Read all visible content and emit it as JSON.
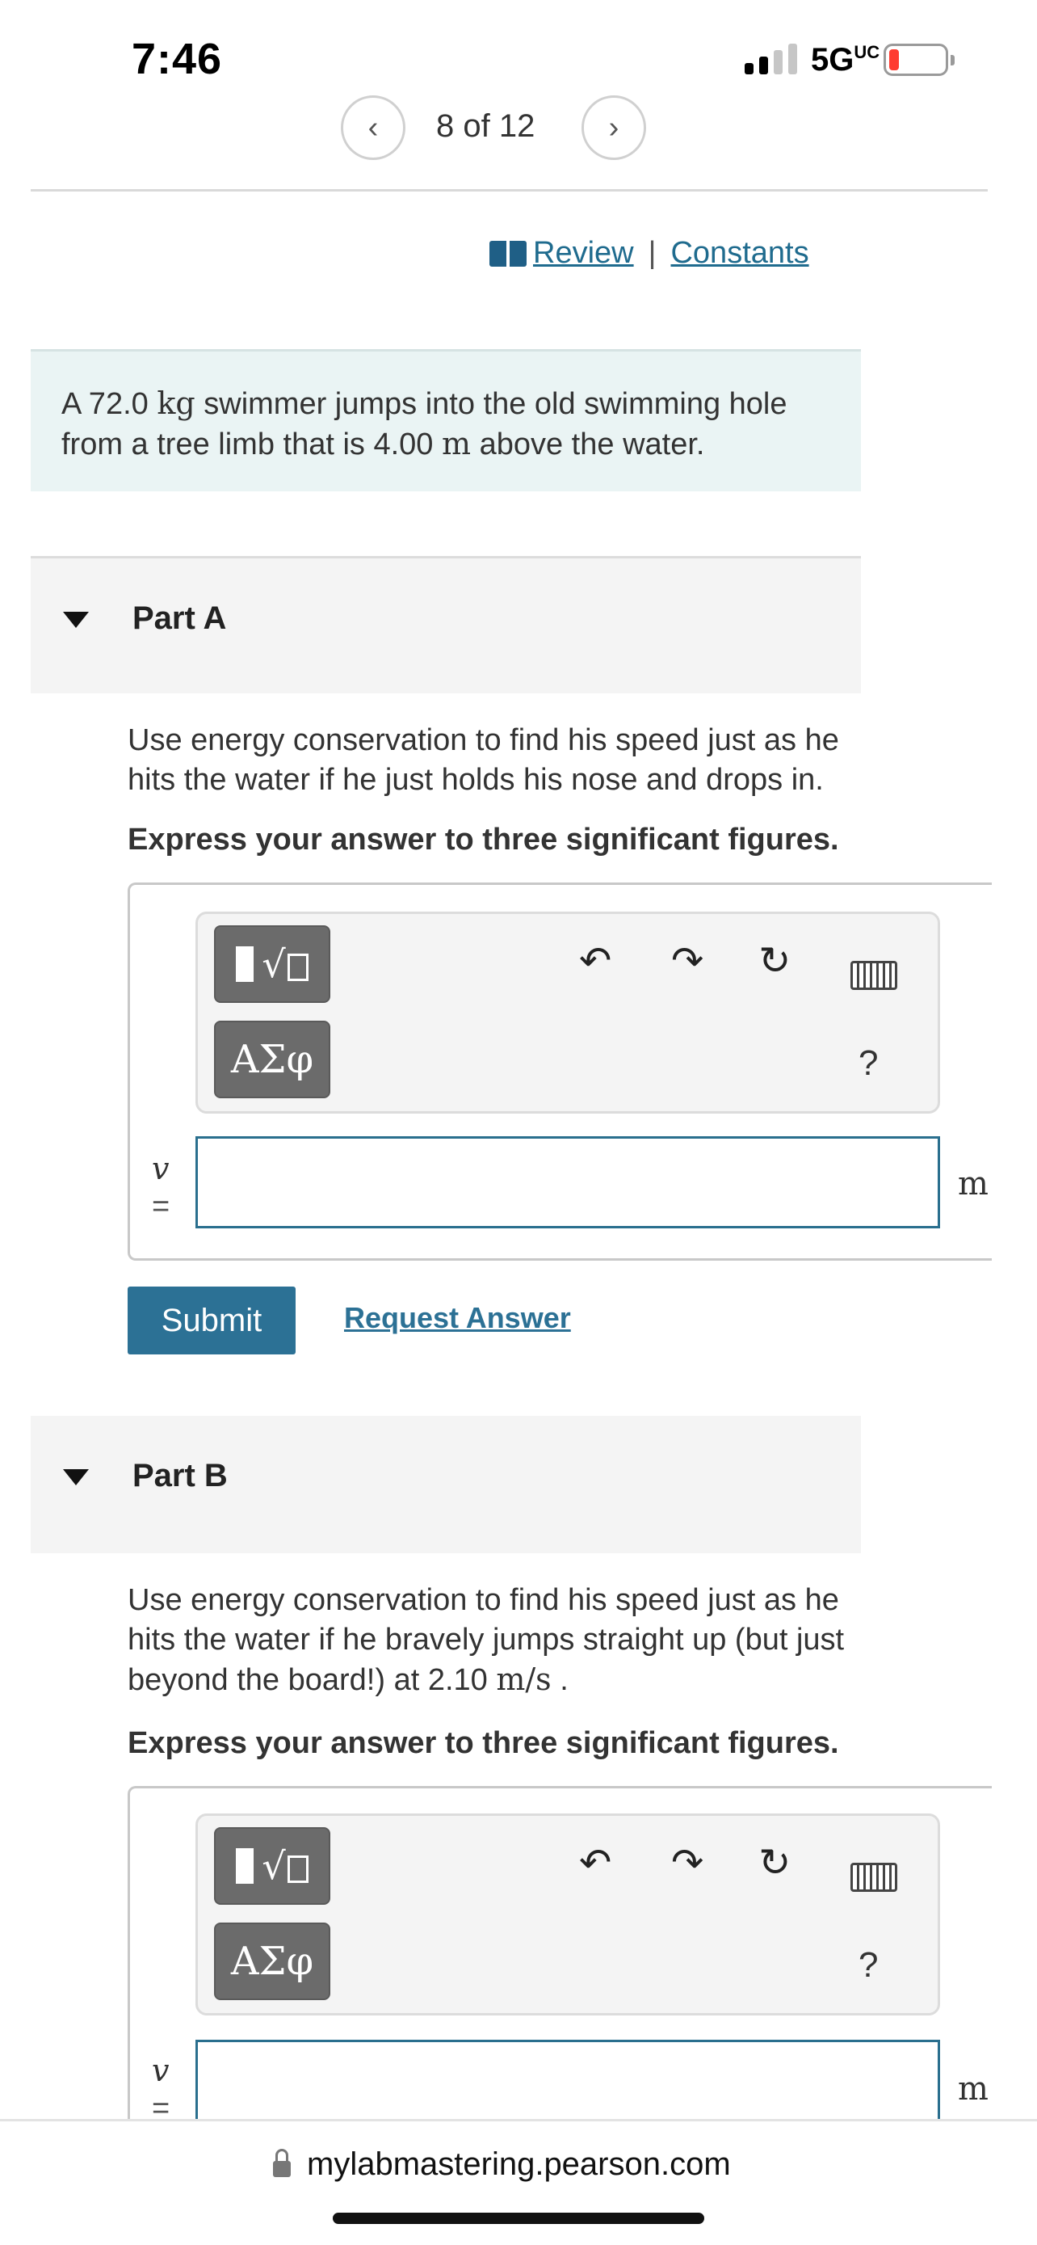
{
  "status_bar": {
    "time": "7:46",
    "network": "5G",
    "network_suffix": "UC"
  },
  "pager": {
    "text": "8 of 12",
    "prev_icon": "chevron-left-icon",
    "next_icon": "chevron-right-icon"
  },
  "header_links": {
    "review": "Review",
    "separator": "|",
    "constants": "Constants"
  },
  "problem": {
    "pre": "A 72.0 ",
    "unit1": "kg",
    "mid": " swimmer jumps into the old swimming hole from a tree limb that is 4.00 ",
    "unit2": "m",
    "post": " above the water."
  },
  "part_a": {
    "title": "Part A",
    "question": "Use energy conservation to find his speed just as he hits the water if he just holds his nose and drops in.",
    "instruction": "Express your answer to three significant figures.",
    "variable": "v",
    "equals": "=",
    "input_value": "",
    "unit": "m",
    "submit_label": "Submit",
    "request_label": "Request Answer",
    "greek_label": "ΑΣφ",
    "help_label": "?"
  },
  "part_b": {
    "title": "Part B",
    "question_pre": "Use energy conservation to find his speed just as he hits the water if he bravely jumps straight up (but just beyond the board!) at 2.10 ",
    "question_unit": "m/s",
    "question_post": " .",
    "instruction": "Express your answer to three significant figures.",
    "variable": "v",
    "equals": "=",
    "input_value": "",
    "unit": "m",
    "greek_label": "ΑΣφ",
    "help_label": "?"
  },
  "browser": {
    "url": "mylabmastering.pearson.com"
  },
  "colors": {
    "accent": "#2c7195",
    "problem_bg": "#eaf4f4",
    "battery_low": "#ff3b30"
  }
}
